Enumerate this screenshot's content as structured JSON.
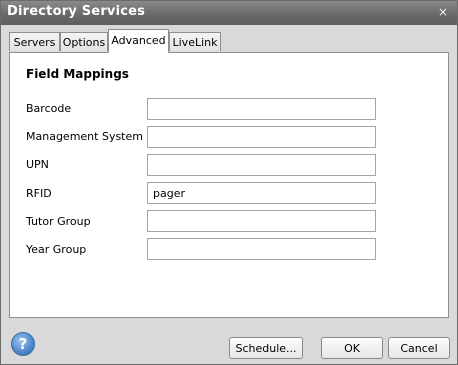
{
  "window": {
    "title": "Directory Services",
    "close_glyph": "×"
  },
  "tabs": [
    {
      "label": "Servers",
      "active": false
    },
    {
      "label": "Options",
      "active": false
    },
    {
      "label": "Advanced",
      "active": true
    },
    {
      "label": "LiveLink",
      "active": false
    }
  ],
  "panel": {
    "section_title": "Field Mappings",
    "fields": [
      {
        "label": "Barcode",
        "value": ""
      },
      {
        "label": "Management System ID",
        "value": ""
      },
      {
        "label": "UPN",
        "value": ""
      },
      {
        "label": "RFID",
        "value": "pager"
      },
      {
        "label": "Tutor Group",
        "value": ""
      },
      {
        "label": "Year Group",
        "value": ""
      }
    ]
  },
  "footer": {
    "help_glyph": "?",
    "schedule_label": "Schedule...",
    "ok_label": "OK",
    "cancel_label": "Cancel"
  },
  "colors": {
    "titlebar": "#6a6a6a",
    "window_bg": "#d9d9d9",
    "panel_bg": "#ffffff",
    "help_icon": "#4f86c9"
  }
}
